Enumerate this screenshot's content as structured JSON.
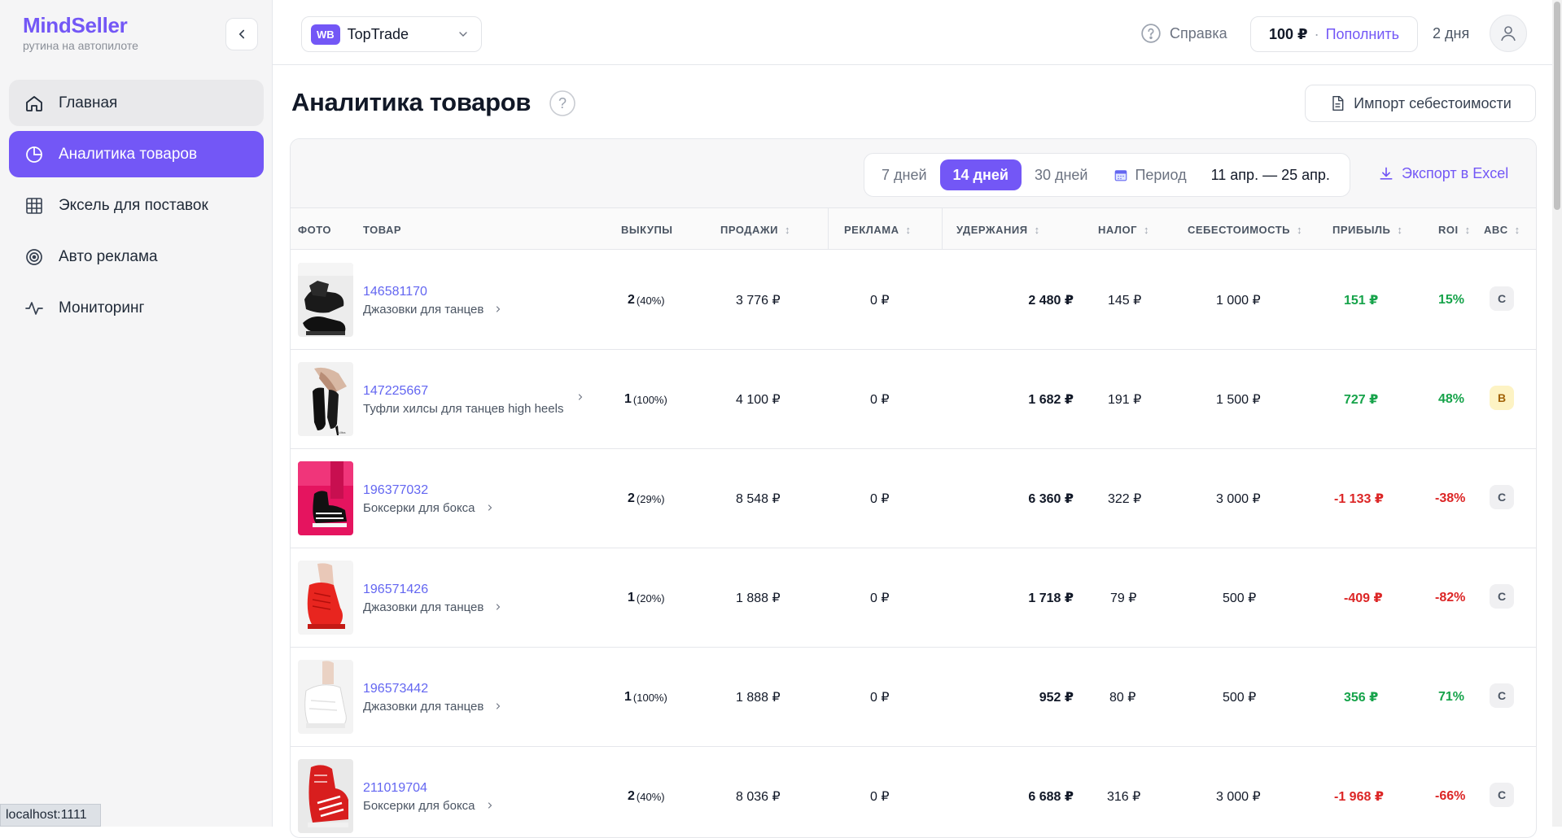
{
  "brand": {
    "name": "MindSeller",
    "tagline": "рутина на автопилоте"
  },
  "nav": [
    {
      "label": "Главная",
      "icon": "home-icon"
    },
    {
      "label": "Аналитика товаров",
      "icon": "pie-chart-icon"
    },
    {
      "label": "Эксель для поставок",
      "icon": "grid-table-icon"
    },
    {
      "label": "Авто реклама",
      "icon": "target-icon"
    },
    {
      "label": "Мониторинг",
      "icon": "pulse-icon"
    }
  ],
  "topbar": {
    "store_badge": "WB",
    "store_name": "TopTrade",
    "help_label": "Справка",
    "balance": "100 ₽",
    "separator": "·",
    "topup_label": "Пополнить",
    "days_left": "2 дня"
  },
  "page": {
    "title": "Аналитика товаров",
    "title_help": "?",
    "import_label": "Импорт себестоимости"
  },
  "toolbar": {
    "periods": [
      "7 дней",
      "14 дней",
      "30 дней"
    ],
    "active_period": "14 дней",
    "custom_period_label": "Период",
    "date_range": "11 апр. — 25 апр.",
    "export_label": "Экспорт в Excel"
  },
  "table": {
    "headers": {
      "photo": "ФОТО",
      "product": "ТОВАР",
      "buyouts": "ВЫКУПЫ",
      "sales": "ПРОДАЖИ",
      "ads": "РЕКЛАМА",
      "deductions": "УДЕРЖАНИЯ",
      "tax": "НАЛОГ",
      "cost": "СЕБЕСТОИМОСТЬ",
      "profit": "ПРИБЫЛЬ",
      "roi": "ROI",
      "abc": "ABC"
    },
    "sort_glyph": "↕",
    "chevron": "›",
    "rows": [
      {
        "id": "146581170",
        "name": "Джазовки для танцев",
        "buyouts": "2",
        "buyouts_pct": "(40%)",
        "sales": "3 776 ₽",
        "ads": "0 ₽",
        "deductions": "2 480 ₽",
        "tax": "145 ₽",
        "cost": "1 000 ₽",
        "profit": "151 ₽",
        "roi": "15%",
        "abc": "C",
        "profit_sign": "pos"
      },
      {
        "id": "147225667",
        "name": "Туфли хилсы для танцев high heels",
        "buyouts": "1",
        "buyouts_pct": "(100%)",
        "sales": "4 100 ₽",
        "ads": "0 ₽",
        "deductions": "1 682 ₽",
        "tax": "191 ₽",
        "cost": "1 500 ₽",
        "profit": "727 ₽",
        "roi": "48%",
        "abc": "B",
        "profit_sign": "pos"
      },
      {
        "id": "196377032",
        "name": "Боксерки для бокса",
        "buyouts": "2",
        "buyouts_pct": "(29%)",
        "sales": "8 548 ₽",
        "ads": "0 ₽",
        "deductions": "6 360 ₽",
        "tax": "322 ₽",
        "cost": "3 000 ₽",
        "profit": "-1 133 ₽",
        "roi": "-38%",
        "abc": "C",
        "profit_sign": "neg"
      },
      {
        "id": "196571426",
        "name": "Джазовки для танцев",
        "buyouts": "1",
        "buyouts_pct": "(20%)",
        "sales": "1 888 ₽",
        "ads": "0 ₽",
        "deductions": "1 718 ₽",
        "tax": "79 ₽",
        "cost": "500 ₽",
        "profit": "-409 ₽",
        "roi": "-82%",
        "abc": "C",
        "profit_sign": "neg"
      },
      {
        "id": "196573442",
        "name": "Джазовки для танцев",
        "buyouts": "1",
        "buyouts_pct": "(100%)",
        "sales": "1 888 ₽",
        "ads": "0 ₽",
        "deductions": "952 ₽",
        "tax": "80 ₽",
        "cost": "500 ₽",
        "profit": "356 ₽",
        "roi": "71%",
        "abc": "C",
        "profit_sign": "pos"
      },
      {
        "id": "211019704",
        "name": "Боксерки для бокса",
        "buyouts": "2",
        "buyouts_pct": "(40%)",
        "sales": "8 036 ₽",
        "ads": "0 ₽",
        "deductions": "6 688 ₽",
        "tax": "316 ₽",
        "cost": "3 000 ₽",
        "profit": "-1 968 ₽",
        "roi": "-66%",
        "abc": "C",
        "profit_sign": "neg"
      }
    ]
  },
  "statusbar": {
    "url": "localhost:1111"
  },
  "colors": {
    "accent": "#7357f6",
    "positive": "#16a34a",
    "negative": "#dc2626",
    "link": "#6366f1"
  }
}
